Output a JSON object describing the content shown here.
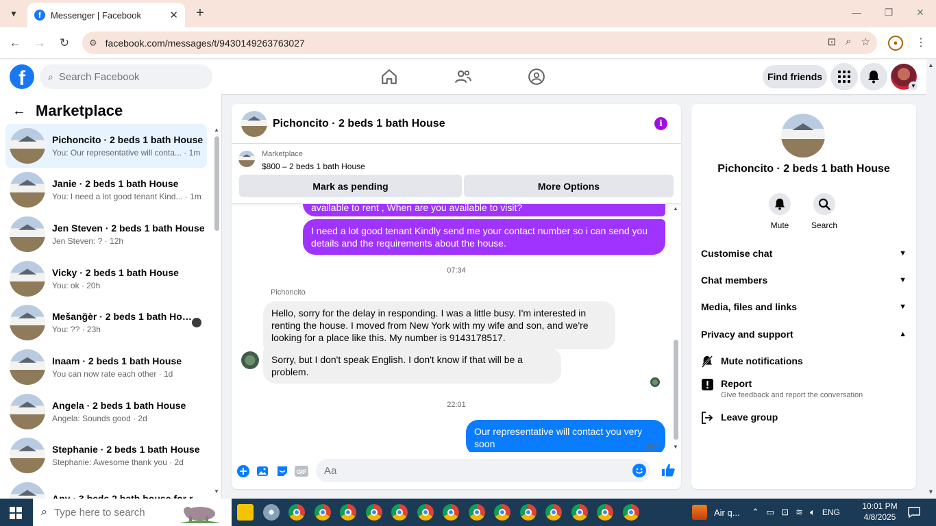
{
  "browser": {
    "tab_title": "Messenger | Facebook",
    "url": "facebook.com/messages/t/9430149263763027"
  },
  "fb_nav": {
    "search_placeholder": "Search Facebook",
    "find_friends": "Find friends"
  },
  "sidebar": {
    "title": "Marketplace",
    "conversations": [
      {
        "name": "Pichoncito · 2 beds 1 bath House",
        "preview": "You: Our representative will conta... · 1m",
        "active": true
      },
      {
        "name": "Janie · 2 beds 1 bath House",
        "preview": "You: I need a lot good tenant Kind... · 1m"
      },
      {
        "name": "Jen Steven · 2 beds 1 bath House",
        "preview": "Jen Steven: ? · 12h"
      },
      {
        "name": "Vicky · 2 beds 1 bath House",
        "preview": "You: ok · 20h"
      },
      {
        "name": "Mešanğèr · 2 beds 1 bath Hou...",
        "preview": "You: ?? · 23h"
      },
      {
        "name": "Inaam · 2 beds 1 bath House",
        "preview": "You can now rate each other · 1d"
      },
      {
        "name": "Angela · 2 beds 1 bath House",
        "preview": "Angela: Sounds good · 2d"
      },
      {
        "name": "Stephanie · 2 beds 1 bath House",
        "preview": "Stephanie: Awesome thank you · 2d"
      },
      {
        "name": "Any · 3 beds 2 bath house for rent",
        "preview": ""
      }
    ]
  },
  "chat": {
    "title": "Pichoncito · 2 beds 1 bath House",
    "listing_source": "Marketplace",
    "listing_price": "$800 – 2 beds 1 bath House",
    "mark_pending": "Mark as pending",
    "more_options": "More Options",
    "messages": {
      "out_partial": "available to rent , When are you available to visit?",
      "out_1": "I need a lot good tenant Kindly send me your contact number so i can send you details and the requirements about the house.",
      "time_1": "07:34",
      "sender": "Pichoncito",
      "in_1": "Hello, sorry for the delay in responding. I was a little busy. I'm interested in renting the house. I moved from New York with my wife and son, and we're looking for a place like this. My number is 9143178517.",
      "in_2": "Sorry, but I don't speak English. I don't know if that will be a problem.",
      "time_2": "22:01",
      "out_2": "Our representative will contact you very soon",
      "status": "Sent"
    },
    "composer_placeholder": "Aa"
  },
  "info_panel": {
    "name": "Pichoncito · 2 beds 1 bath House",
    "actions": {
      "mute": "Mute",
      "search": "Search"
    },
    "sections": {
      "customise": "Customise chat",
      "members": "Chat members",
      "media": "Media, files and links",
      "privacy": "Privacy and support"
    },
    "options": {
      "mute_notifications": "Mute notifications",
      "report": "Report",
      "report_sub": "Give feedback and report the conversation",
      "leave": "Leave group"
    }
  },
  "taskbar": {
    "search_placeholder": "Type here to search",
    "weather": "Air q...",
    "language": "ENG",
    "time": "10:01 PM",
    "date": "4/8/2025"
  },
  "colors": {
    "fb_blue": "#1877f2",
    "outgoing_purple": "#a033ff",
    "outgoing_blue": "#0a7cff",
    "info_purple": "#a10fe0",
    "browser_tint": "#f9e4db"
  }
}
